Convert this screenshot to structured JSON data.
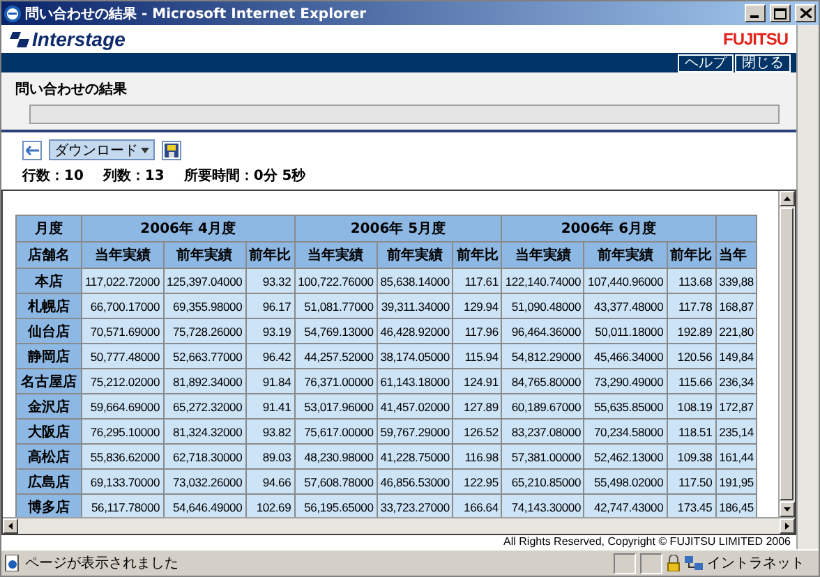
{
  "window": {
    "title": "問い合わせの結果 - Microsoft Internet Explorer"
  },
  "header": {
    "logo": "Interstage",
    "brand": "FUJITSU",
    "nav_buttons": [
      "ヘルプ",
      "閉じる"
    ]
  },
  "page_title": "問い合わせの結果",
  "toolbar": {
    "dropdown": "ダウンロード"
  },
  "stats": [
    "行数：10",
    "列数：13",
    "所要時間：0分 5秒"
  ],
  "table": {
    "corner_top": "月度",
    "corner_bottom": "店舗名",
    "months": [
      "2006年 4月度",
      "2006年 5月度",
      "2006年 6月度"
    ],
    "columns": [
      "当年実績",
      "前年実績",
      "前年比",
      "当年実績",
      "前年実績",
      "前年比",
      "当年実績",
      "前年実績",
      "前年比",
      "当年"
    ],
    "rows": [
      {
        "store": "本店",
        "cells": [
          "117,022.72000",
          "125,397.04000",
          "93.32",
          "100,722.76000",
          "85,638.14000",
          "117.61",
          "122,140.74000",
          "107,440.96000",
          "113.68",
          "339,88"
        ]
      },
      {
        "store": "札幌店",
        "cells": [
          "66,700.17000",
          "69,355.98000",
          "96.17",
          "51,081.77000",
          "39,311.34000",
          "129.94",
          "51,090.48000",
          "43,377.48000",
          "117.78",
          "168,87"
        ]
      },
      {
        "store": "仙台店",
        "cells": [
          "70,571.69000",
          "75,728.26000",
          "93.19",
          "54,769.13000",
          "46,428.92000",
          "117.96",
          "96,464.36000",
          "50,011.18000",
          "192.89",
          "221,80"
        ]
      },
      {
        "store": "静岡店",
        "cells": [
          "50,777.48000",
          "52,663.77000",
          "96.42",
          "44,257.52000",
          "38,174.05000",
          "115.94",
          "54,812.29000",
          "45,466.34000",
          "120.56",
          "149,84"
        ]
      },
      {
        "store": "名古屋店",
        "cells": [
          "75,212.02000",
          "81,892.34000",
          "91.84",
          "76,371.00000",
          "61,143.18000",
          "124.91",
          "84,765.80000",
          "73,290.49000",
          "115.66",
          "236,34"
        ]
      },
      {
        "store": "金沢店",
        "cells": [
          "59,664.69000",
          "65,272.32000",
          "91.41",
          "53,017.96000",
          "41,457.02000",
          "127.89",
          "60,189.67000",
          "55,635.85000",
          "108.19",
          "172,87"
        ]
      },
      {
        "store": "大阪店",
        "cells": [
          "76,295.10000",
          "81,324.32000",
          "93.82",
          "75,617.00000",
          "59,767.29000",
          "126.52",
          "83,237.08000",
          "70,234.58000",
          "118.51",
          "235,14"
        ]
      },
      {
        "store": "高松店",
        "cells": [
          "55,836.62000",
          "62,718.30000",
          "89.03",
          "48,230.98000",
          "41,228.75000",
          "116.98",
          "57,381.00000",
          "52,462.13000",
          "109.38",
          "161,44"
        ]
      },
      {
        "store": "広島店",
        "cells": [
          "69,133.70000",
          "73,032.26000",
          "94.66",
          "57,608.78000",
          "46,856.53000",
          "122.95",
          "65,210.85000",
          "55,498.02000",
          "117.50",
          "191,95"
        ]
      },
      {
        "store": "博多店",
        "cells": [
          "56,117.78000",
          "54,646.49000",
          "102.69",
          "56,195.65000",
          "33,723.27000",
          "166.64",
          "74,143.30000",
          "42,747.43000",
          "173.45",
          "186,45"
        ]
      }
    ]
  },
  "copyright": "All Rights Reserved, Copyright © FUJITSU LIMITED 2006",
  "status_bar": {
    "message": "ページが表示されました",
    "zone": "イントラネット"
  }
}
